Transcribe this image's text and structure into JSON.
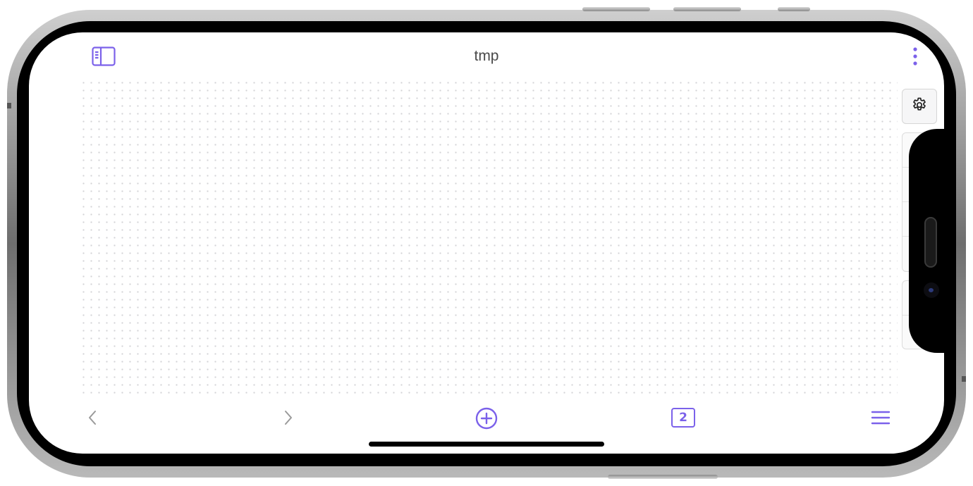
{
  "app": {
    "title": "tmp"
  },
  "top_bar": {
    "sidebar_toggle_icon": "sidebar-icon",
    "more_icon": "more-vertical-icon"
  },
  "canvas": {
    "background": "dot-grid"
  },
  "side_panel": {
    "settings_icon": "gear-icon"
  },
  "bottom_bar": {
    "back_icon": "chevron-left-icon",
    "forward_icon": "chevron-right-icon",
    "add_icon": "plus-circle-icon",
    "page_count": "2",
    "menu_icon": "hamburger-menu-icon"
  },
  "colors": {
    "accent": "#7b61ea",
    "disabled": "#9a9a9a",
    "title_text": "#4a4a4a"
  }
}
